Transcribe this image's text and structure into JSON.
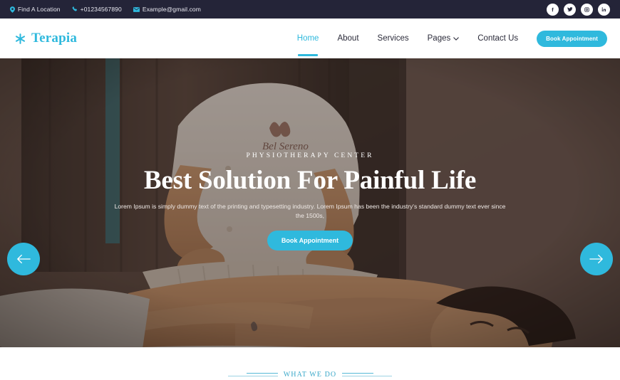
{
  "topbar": {
    "location": {
      "icon": "map-pin-icon",
      "label": "Find A Location"
    },
    "phone": {
      "icon": "phone-icon",
      "label": "+01234567890"
    },
    "email": {
      "icon": "envelope-icon",
      "label": "Example@gmail.com"
    },
    "socials": [
      {
        "name": "facebook-icon",
        "label": "f"
      },
      {
        "name": "twitter-icon",
        "label": "t"
      },
      {
        "name": "instagram-icon",
        "label": "ig"
      },
      {
        "name": "linkedin-icon",
        "label": "in"
      }
    ],
    "bg_color": "#242438",
    "icon_color": "#2fb9dd"
  },
  "header": {
    "logo": {
      "icon": "asterisk-icon",
      "text": "Terapia"
    },
    "nav": [
      {
        "label": "Home",
        "active": true
      },
      {
        "label": "About",
        "active": false
      },
      {
        "label": "Services",
        "active": false
      },
      {
        "label": "Pages",
        "active": false,
        "has_dropdown": true
      },
      {
        "label": "Contact Us",
        "active": false
      }
    ],
    "cta_label": "Book Appointment",
    "accent_color": "#2fb9dd"
  },
  "hero": {
    "eyebrow": "PHYSIOTHERAPY CENTER",
    "title": "Best Solution For Painful Life",
    "paragraph": "Lorem Ipsum is simply dummy text of the printing and typesetting industry. Lorem Ipsum has been the industry's standard dummy text ever since the 1500s,",
    "cta_label": "Book Appointment",
    "prev_arrow": "arrow-left-icon",
    "next_arrow": "arrow-right-icon",
    "image_description": "Physiotherapist in a white coat massaging a woman lying face down on a treatment table in a dim clinic room"
  },
  "what_we_do": {
    "eyebrow": "WHAT WE DO",
    "accent_color": "#3aa8c9"
  }
}
